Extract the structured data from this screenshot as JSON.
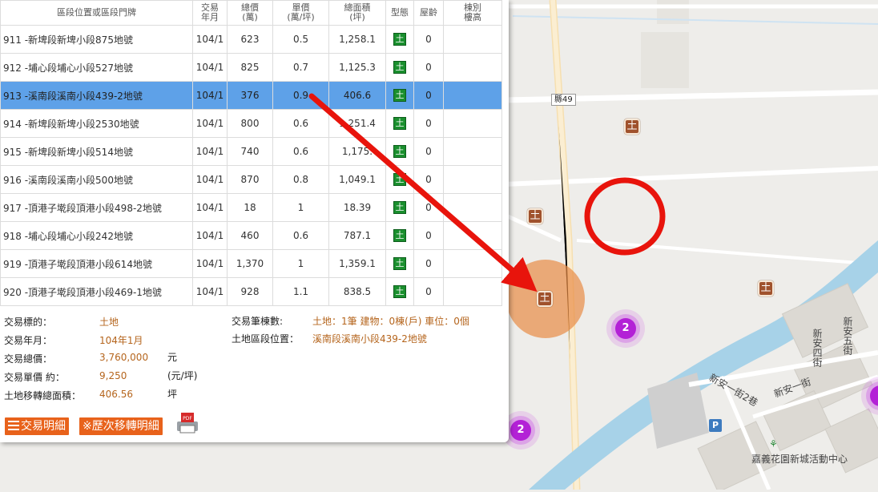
{
  "colors": {
    "accent": "#5ea1e8",
    "value": "#b5651d",
    "button": "#e8621b",
    "land": "#1a8f2e",
    "arrow": "#e8140c",
    "cluster": "#b321d6"
  },
  "table": {
    "headers": [
      "區段位置或區段門牌",
      "交易\n年月",
      "總價\n(萬)",
      "單價\n(萬/坪)",
      "總面積\n(坪)",
      "型態",
      "屋齡",
      "棟別\n樓高"
    ],
    "rows": [
      {
        "addr": "911 -新埤段新埤小段875地號",
        "date": "104/1",
        "total": "623",
        "unit": "0.5",
        "area": "1,258.1",
        "type": "土",
        "age": "0",
        "floor": ""
      },
      {
        "addr": "912 -埔心段埔心小段527地號",
        "date": "104/1",
        "total": "825",
        "unit": "0.7",
        "area": "1,125.3",
        "type": "土",
        "age": "0",
        "floor": ""
      },
      {
        "addr": "913 -溪南段溪南小段439-2地號",
        "date": "104/1",
        "total": "376",
        "unit": "0.9",
        "area": "406.6",
        "type": "土",
        "age": "0",
        "floor": ""
      },
      {
        "addr": "914 -新埤段新埤小段2530地號",
        "date": "104/1",
        "total": "800",
        "unit": "0.6",
        "area": "1,251.4",
        "type": "土",
        "age": "0",
        "floor": ""
      },
      {
        "addr": "915 -新埤段新埤小段514地號",
        "date": "104/1",
        "total": "740",
        "unit": "0.6",
        "area": "1,175.",
        "type": "土",
        "age": "0",
        "floor": ""
      },
      {
        "addr": "916 -溪南段溪南小段500地號",
        "date": "104/1",
        "total": "870",
        "unit": "0.8",
        "area": "1,049.1",
        "type": "土",
        "age": "0",
        "floor": ""
      },
      {
        "addr": "917 -頂港子墘段頂港小段498-2地號",
        "date": "104/1",
        "total": "18",
        "unit": "1",
        "area": "18.39",
        "type": "土",
        "age": "0",
        "floor": ""
      },
      {
        "addr": "918 -埔心段埔心小段242地號",
        "date": "104/1",
        "total": "460",
        "unit": "0.6",
        "area": "787.1",
        "type": "土",
        "age": "0",
        "floor": ""
      },
      {
        "addr": "919 -頂港子墘段頂港小段614地號",
        "date": "104/1",
        "total": "1,370",
        "unit": "1",
        "area": "1,359.1",
        "type": "土",
        "age": "0",
        "floor": ""
      },
      {
        "addr": "920 -頂港子墘段頂港小段469-1地號",
        "date": "104/1",
        "total": "928",
        "unit": "1.1",
        "area": "838.5",
        "type": "土",
        "age": "0",
        "floor": ""
      }
    ]
  },
  "detail": {
    "target_label": "交易標的：",
    "target_value": "土地",
    "date_label": "交易年月：",
    "date_value": "104年1月",
    "total_label": "交易總價：",
    "total_value": "3,760,000",
    "total_unit": "元",
    "unit_label": "交易單價 約：",
    "unit_value": "9,250",
    "unit_unit": "(元/坪)",
    "area_label": "土地移轉總面積：",
    "area_value": "406.56",
    "area_unit": "坪",
    "count_label": "交易筆棟數:",
    "count_value": "土地：1筆 建物：0棟(戶) 車位：0個",
    "location_label": "土地區段位置：",
    "location_value": "溪南段溪南小段439-2地號"
  },
  "buttons": {
    "detail": "交易明細",
    "history": "※歷次移轉明細",
    "pdf": "PDF"
  },
  "map": {
    "road_tag": "縣49",
    "streets": [
      "新安四街",
      "新安五街",
      "新安一街",
      "新安一街2巷"
    ],
    "poi": "嘉義花園新城活動中心",
    "parking": "P",
    "cluster_counts": [
      "2",
      "2"
    ],
    "land_marker": "土"
  }
}
